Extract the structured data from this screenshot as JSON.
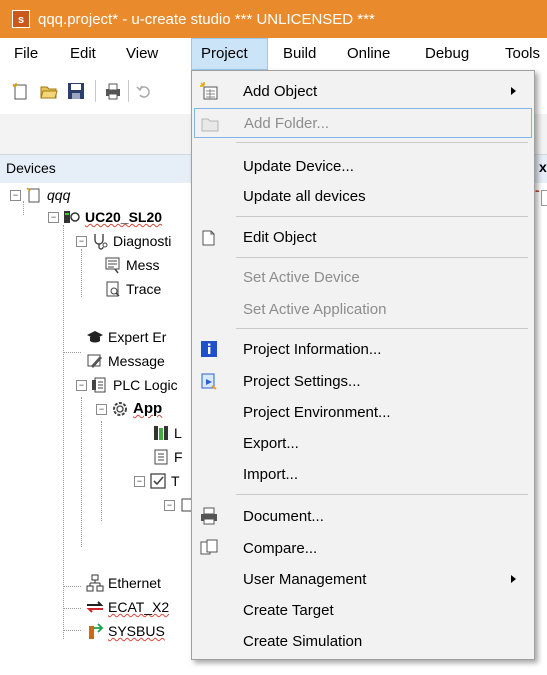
{
  "window": {
    "title": "qqq.project* - u-create studio *** UNLICENSED ***"
  },
  "menubar": {
    "items": [
      {
        "label": "File"
      },
      {
        "label": "Edit"
      },
      {
        "label": "View"
      },
      {
        "label": "Project"
      },
      {
        "label": "Build"
      },
      {
        "label": "Online"
      },
      {
        "label": "Debug"
      },
      {
        "label": "Tools"
      }
    ],
    "active": "Project"
  },
  "devices_panel": {
    "title": "Devices",
    "tree": [
      {
        "label": "qqq"
      },
      {
        "label": "UC20_SL20"
      },
      {
        "label": "Diagnosti"
      },
      {
        "label": "Mess"
      },
      {
        "label": "Trace"
      },
      {
        "label": "Expert Er"
      },
      {
        "label": "Message"
      },
      {
        "label": "PLC Logic"
      },
      {
        "label": "App"
      },
      {
        "label": "L"
      },
      {
        "label": "F"
      },
      {
        "label": "T"
      },
      {
        "label": ""
      },
      {
        "label": "Ethernet"
      },
      {
        "label": "ECAT_X2"
      },
      {
        "label": "SYSBUS"
      }
    ]
  },
  "project_menu": {
    "items": [
      {
        "label": "Add Object",
        "icon": "add-object-icon",
        "submenu": true,
        "enabled": true
      },
      {
        "label": "Add Folder...",
        "icon": "folder-icon",
        "enabled": false,
        "highlight": true
      },
      {
        "label": "Update Device...",
        "enabled": true
      },
      {
        "label": "Update all devices",
        "enabled": true
      },
      {
        "label": "Edit Object",
        "icon": "edit-object-icon",
        "enabled": true
      },
      {
        "label": "Set Active Device",
        "enabled": false
      },
      {
        "label": "Set Active Application",
        "enabled": false
      },
      {
        "label": "Project Information...",
        "icon": "info-icon",
        "enabled": true
      },
      {
        "label": "Project Settings...",
        "icon": "settings-icon",
        "enabled": true
      },
      {
        "label": "Project Environment...",
        "enabled": true
      },
      {
        "label": "Export...",
        "enabled": true
      },
      {
        "label": "Import...",
        "enabled": true
      },
      {
        "label": "Document...",
        "icon": "printer-icon",
        "enabled": true
      },
      {
        "label": "Compare...",
        "icon": "compare-icon",
        "enabled": true
      },
      {
        "label": "User Management",
        "submenu": true,
        "enabled": true
      },
      {
        "label": "Create Target",
        "enabled": true
      },
      {
        "label": "Create Simulation",
        "enabled": true
      }
    ]
  },
  "colors": {
    "titlebar": "#e98a2c",
    "menu_active": "#cce4f7",
    "menu_bg": "#f2f2f2",
    "highlight_border": "#7fb6e5"
  }
}
